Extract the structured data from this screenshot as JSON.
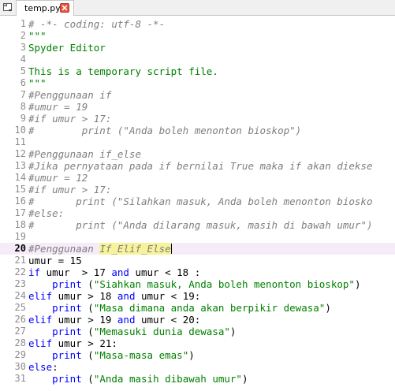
{
  "tab": {
    "filename": "temp.py",
    "active": true
  },
  "colors": {
    "comment": "#7f7f7f",
    "string": "#008000",
    "keyword": "#0000ff",
    "current_line": "#f6ebf9",
    "highlight": "#f7f39a",
    "close_button": "#e8553e"
  },
  "editor": {
    "current_line": 20,
    "lines": [
      {
        "n": "1",
        "tokens": [
          [
            "comment",
            "# -*- coding: utf-8 -*-"
          ]
        ]
      },
      {
        "n": "2",
        "tokens": [
          [
            "string",
            "\"\"\""
          ]
        ]
      },
      {
        "n": "3",
        "tokens": [
          [
            "string",
            "Spyder Editor"
          ]
        ]
      },
      {
        "n": "4",
        "tokens": []
      },
      {
        "n": "5",
        "tokens": [
          [
            "string",
            "This is a temporary script file."
          ]
        ]
      },
      {
        "n": "6",
        "tokens": [
          [
            "string",
            "\"\"\""
          ]
        ]
      },
      {
        "n": "7",
        "tokens": [
          [
            "comment",
            "#Penggunaan if"
          ]
        ]
      },
      {
        "n": "8",
        "tokens": [
          [
            "comment",
            "#umur = 19"
          ]
        ]
      },
      {
        "n": "9",
        "tokens": [
          [
            "comment",
            "#if umur > 17:"
          ]
        ]
      },
      {
        "n": "10",
        "tokens": [
          [
            "comment",
            "#        print (\"Anda boleh menonton bioskop\")"
          ]
        ]
      },
      {
        "n": "11",
        "tokens": []
      },
      {
        "n": "12",
        "tokens": [
          [
            "comment",
            "#Penggunaan if_else"
          ]
        ]
      },
      {
        "n": "13",
        "tokens": [
          [
            "comment",
            "#Jika pernyataan pada if bernilai True maka if akan diekse"
          ]
        ]
      },
      {
        "n": "14",
        "tokens": [
          [
            "comment",
            "#umur = 12"
          ]
        ]
      },
      {
        "n": "15",
        "tokens": [
          [
            "comment",
            "#if umur > 17:"
          ]
        ]
      },
      {
        "n": "16",
        "tokens": [
          [
            "comment",
            "#       print (\"Silahkan masuk, Anda boleh menonton biosko"
          ]
        ]
      },
      {
        "n": "17",
        "tokens": [
          [
            "comment",
            "#else:"
          ]
        ]
      },
      {
        "n": "18",
        "tokens": [
          [
            "comment",
            "#       print (\"Anda dilarang masuk, masih di bawah umur\")"
          ]
        ]
      },
      {
        "n": "19",
        "tokens": []
      },
      {
        "n": "20",
        "tokens": [
          [
            "comment",
            "#Penggunaan "
          ],
          [
            "highlight",
            "If_Elif_Else"
          ],
          [
            "cursor",
            ""
          ]
        ]
      },
      {
        "n": "21",
        "tokens": [
          [
            "plain",
            "umur = 15"
          ]
        ]
      },
      {
        "n": "22",
        "tokens": [
          [
            "keyword",
            "if"
          ],
          [
            "plain",
            " umur  > 17 "
          ],
          [
            "keyword",
            "and"
          ],
          [
            "plain",
            " umur < 18 :"
          ]
        ]
      },
      {
        "n": "23",
        "tokens": [
          [
            "plain",
            "    "
          ],
          [
            "keyword",
            "print"
          ],
          [
            "plain",
            " ("
          ],
          [
            "string",
            "\"Siahkan masuk, Anda boleh menonton bioskop\""
          ],
          [
            "plain",
            ")"
          ]
        ]
      },
      {
        "n": "24",
        "tokens": [
          [
            "keyword",
            "elif"
          ],
          [
            "plain",
            " umur > 18 "
          ],
          [
            "keyword",
            "and"
          ],
          [
            "plain",
            " umur < 19:"
          ]
        ]
      },
      {
        "n": "25",
        "tokens": [
          [
            "plain",
            "    "
          ],
          [
            "keyword",
            "print"
          ],
          [
            "plain",
            " ("
          ],
          [
            "string",
            "\"Masa dimana anda akan berpikir dewasa\""
          ],
          [
            "plain",
            ")"
          ]
        ]
      },
      {
        "n": "26",
        "tokens": [
          [
            "keyword",
            "elif"
          ],
          [
            "plain",
            " umur > 19 "
          ],
          [
            "keyword",
            "and"
          ],
          [
            "plain",
            " umur < 20:"
          ]
        ]
      },
      {
        "n": "27",
        "tokens": [
          [
            "plain",
            "    "
          ],
          [
            "keyword",
            "print"
          ],
          [
            "plain",
            " ("
          ],
          [
            "string",
            "\"Memasuki dunia dewasa\""
          ],
          [
            "plain",
            ")"
          ]
        ]
      },
      {
        "n": "28",
        "tokens": [
          [
            "keyword",
            "elif"
          ],
          [
            "plain",
            " umur > 21:"
          ]
        ]
      },
      {
        "n": "29",
        "tokens": [
          [
            "plain",
            "    "
          ],
          [
            "keyword",
            "print"
          ],
          [
            "plain",
            " ("
          ],
          [
            "string",
            "\"Masa-masa emas\""
          ],
          [
            "plain",
            ")"
          ]
        ]
      },
      {
        "n": "30",
        "tokens": [
          [
            "keyword",
            "else"
          ],
          [
            "plain",
            ":"
          ]
        ]
      },
      {
        "n": "31",
        "tokens": [
          [
            "plain",
            "    "
          ],
          [
            "keyword",
            "print"
          ],
          [
            "plain",
            " ("
          ],
          [
            "string",
            "\"Anda masih dibawah umur\""
          ],
          [
            "plain",
            ")"
          ]
        ]
      }
    ]
  }
}
